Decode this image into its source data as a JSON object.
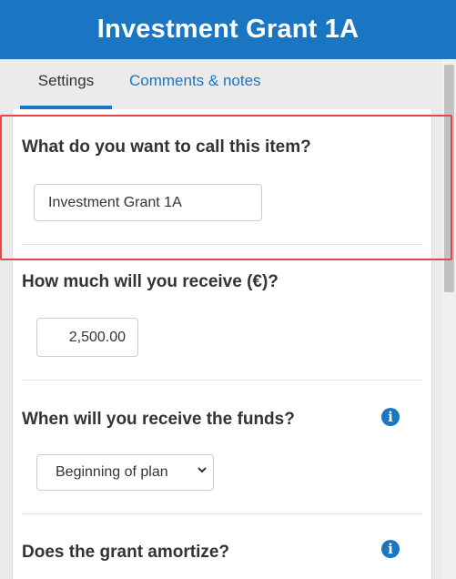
{
  "header": {
    "title": "Investment Grant 1A"
  },
  "tabs": [
    {
      "label": "Settings",
      "active": true
    },
    {
      "label": "Comments & notes",
      "active": false
    }
  ],
  "form": {
    "name": {
      "question": "What do you want to call this item?",
      "value": "Investment Grant 1A"
    },
    "amount": {
      "question": "How much will you receive (€)?",
      "value": "2,500.00"
    },
    "receive_when": {
      "question": "When will you receive the funds?",
      "selected": "Beginning of plan",
      "info_icon": "info-icon"
    },
    "amortize": {
      "question": "Does the grant amortize?",
      "info_icon": "info-icon"
    }
  },
  "colors": {
    "brand": "#1a75c2",
    "highlight": "#e84545"
  }
}
